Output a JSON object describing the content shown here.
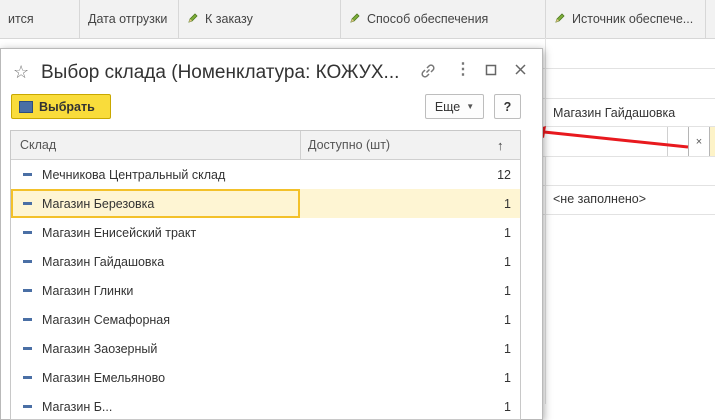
{
  "background_form": {
    "columns": [
      {
        "label": "ится",
        "pencil": false
      },
      {
        "label": "Дата отгрузки",
        "pencil": false
      },
      {
        "label": "К заказу",
        "pencil": true
      },
      {
        "label": "Способ обеспечения",
        "pencil": true
      },
      {
        "label": "Источник обеспече...",
        "pencil": true
      }
    ],
    "row_value_1": "Магазин Гайдашовка",
    "row_value_2": "<не заполнено>",
    "clear_label": "×"
  },
  "dialog": {
    "title": "Выбор склада (Номенклатура: КОЖУХ...",
    "select_button": "Выбрать",
    "more_button": "Еще",
    "help_button": "?",
    "table": {
      "headers": {
        "warehouse": "Склад",
        "available": "Доступно (шт)",
        "sort_indicator": "↑"
      },
      "rows": [
        {
          "name": "Мечникова Центральный склад",
          "available": "12"
        },
        {
          "name": "Магазин Березовка",
          "available": "1"
        },
        {
          "name": "Магазин Енисейский тракт",
          "available": "1"
        },
        {
          "name": "Магазин Гайдашовка",
          "available": "1"
        },
        {
          "name": "Магазин Глинки",
          "available": "1"
        },
        {
          "name": "Магазин Семафорная",
          "available": "1"
        },
        {
          "name": "Магазин Заозерный",
          "available": "1"
        },
        {
          "name": "Магазин Емельяново",
          "available": "1"
        },
        {
          "name": "Магазин Б...",
          "available": "1"
        }
      ],
      "selected_index": 1
    }
  },
  "colors": {
    "accent_yellow": "#f9dc3b",
    "selection": "#fef5d3",
    "arrow_red": "#e8191e"
  }
}
